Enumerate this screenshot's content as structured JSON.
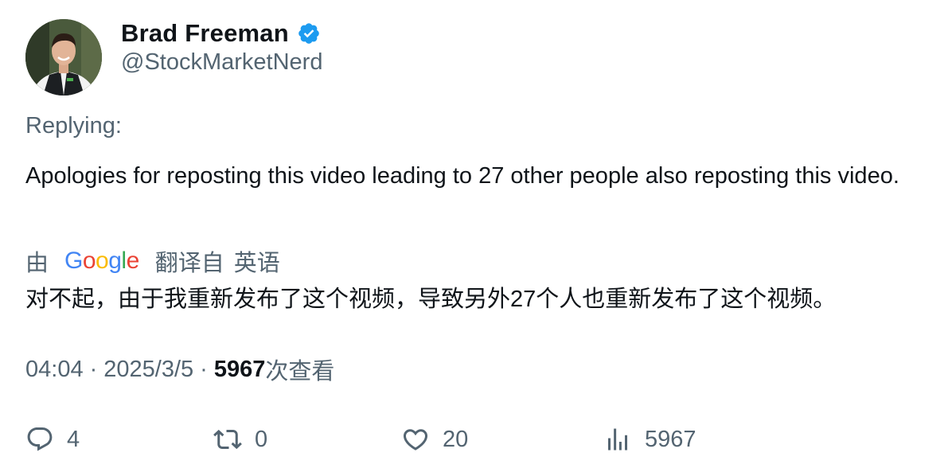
{
  "author": {
    "display_name": "Brad Freeman",
    "handle": "@StockMarketNerd",
    "verified": true
  },
  "replying_label": "Replying:",
  "tweet": {
    "text": "Apologies for reposting this video leading to 27 other people also reposting this video."
  },
  "translation": {
    "prefix": "由",
    "provider": "Google",
    "label": "翻译自",
    "source_language": "英语",
    "text": "对不起，由于我重新发布了这个视频，导致另外27个人也重新发布了这个视频。"
  },
  "meta": {
    "time": "04:04",
    "separator": "·",
    "date": "2025/3/5",
    "views_count": "5967",
    "views_label": "次查看"
  },
  "actions": {
    "reply": {
      "icon": "reply-icon",
      "count": "4"
    },
    "retweet": {
      "icon": "retweet-icon",
      "count": "0"
    },
    "like": {
      "icon": "heart-icon",
      "count": "20"
    },
    "views": {
      "icon": "views-icon",
      "count": "5967"
    }
  },
  "colors": {
    "text_primary": "#0f1419",
    "text_secondary": "#536471",
    "verified_blue": "#1d9bf0",
    "google_blue": "#4285f4",
    "google_red": "#ea4335",
    "google_yellow": "#fbbc05",
    "google_green": "#34a853"
  }
}
